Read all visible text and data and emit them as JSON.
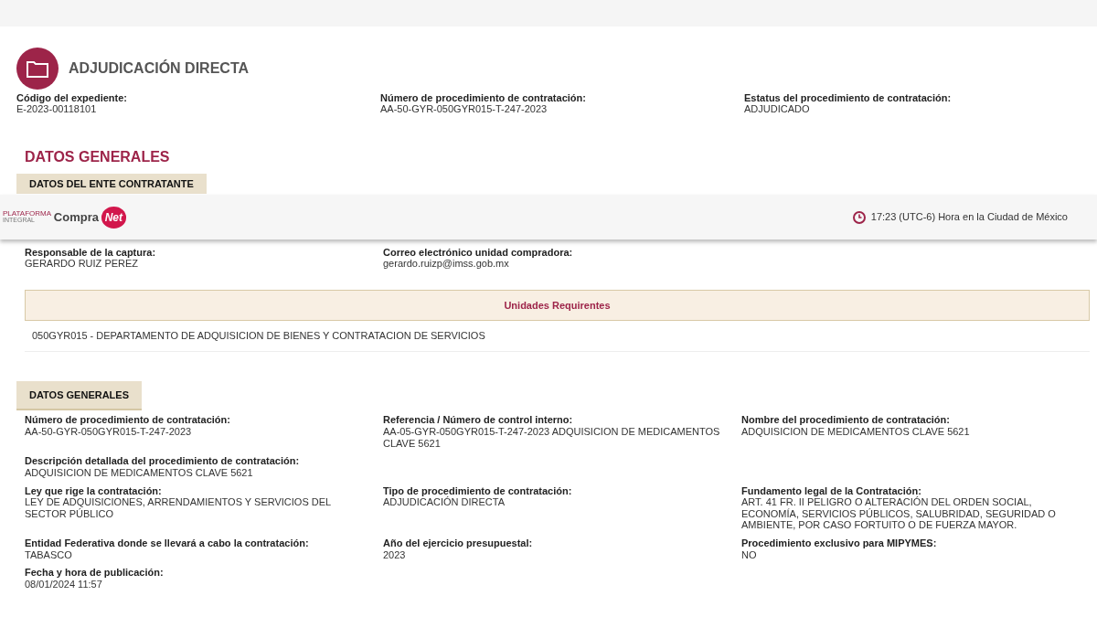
{
  "header": {
    "title": "ADJUDICACIÓN DIRECTA",
    "fields": [
      {
        "label": "Código del expediente:",
        "value": "E-2023-00118101"
      },
      {
        "label": "Número de procedimiento de contratación:",
        "value": "AA-50-GYR-050GYR015-T-247-2023"
      },
      {
        "label": "Estatus del procedimiento de contratación:",
        "value": "ADJUDICADO"
      }
    ]
  },
  "section_title": "DATOS GENERALES",
  "ente": {
    "tab": "DATOS DEL ENTE CONTRATANTE",
    "fields": [
      {
        "label": "Responsable de la captura:",
        "value": "GERARDO RUIZ PEREZ"
      },
      {
        "label": "Correo electrónico unidad compradora:",
        "value": "gerardo.ruizp@imss.gob.mx"
      }
    ]
  },
  "navbar": {
    "platform_top": "PLATAFORMA",
    "platform_bottom": "INTEGRAL",
    "brand": "Compra",
    "brand_mark": "Net",
    "clock": "17:23 (UTC-6) Hora en la Ciudad de México"
  },
  "unidades": {
    "title": "Unidades Requirentes",
    "rows": [
      "050GYR015 - DEPARTAMENTO DE ADQUISICION DE BIENES Y CONTRATACION DE SERVICIOS"
    ]
  },
  "generales": {
    "tab": "DATOS GENERALES",
    "rows": [
      [
        {
          "label": "Número de procedimiento de contratación:",
          "value": "AA-50-GYR-050GYR015-T-247-2023"
        },
        {
          "label": "Referencia / Número de control interno:",
          "value": "AA-05-GYR-050GYR015-T-247-2023 ADQUISICION DE MEDICAMENTOS CLAVE 5621"
        },
        {
          "label": "Nombre del procedimiento de contratación:",
          "value": "ADQUISICION DE MEDICAMENTOS CLAVE 5621"
        }
      ],
      [
        {
          "label": "Descripción detallada del procedimiento de contratación:",
          "value": "ADQUISICION DE MEDICAMENTOS CLAVE 5621"
        }
      ],
      [
        {
          "label": "Ley que rige la contratación:",
          "value": "LEY DE ADQUISICIONES, ARRENDAMIENTOS Y SERVICIOS DEL SECTOR PÚBLICO"
        },
        {
          "label": "Tipo de procedimiento de contratación:",
          "value": "ADJUDICACIÓN DIRECTA"
        },
        {
          "label": "Fundamento legal de la Contratación:",
          "value": "ART. 41 FR. II PELIGRO O ALTERACIÓN DEL ORDEN SOCIAL, ECONOMÍA, SERVICIOS PÚBLICOS, SALUBRIDAD, SEGURIDAD O AMBIENTE, POR CASO FORTUITO O DE FUERZA MAYOR."
        }
      ],
      [
        {
          "label": "Entidad Federativa donde se llevará a cabo la contratación:",
          "value": "TABASCO"
        },
        {
          "label": "Año del ejercicio presupuestal:",
          "value": "2023"
        },
        {
          "label": "Procedimiento exclusivo para MIPYMES:",
          "value": "NO"
        }
      ],
      [
        {
          "label": "Fecha y hora de publicación:",
          "value": "08/01/2024 11:57"
        }
      ]
    ]
  }
}
